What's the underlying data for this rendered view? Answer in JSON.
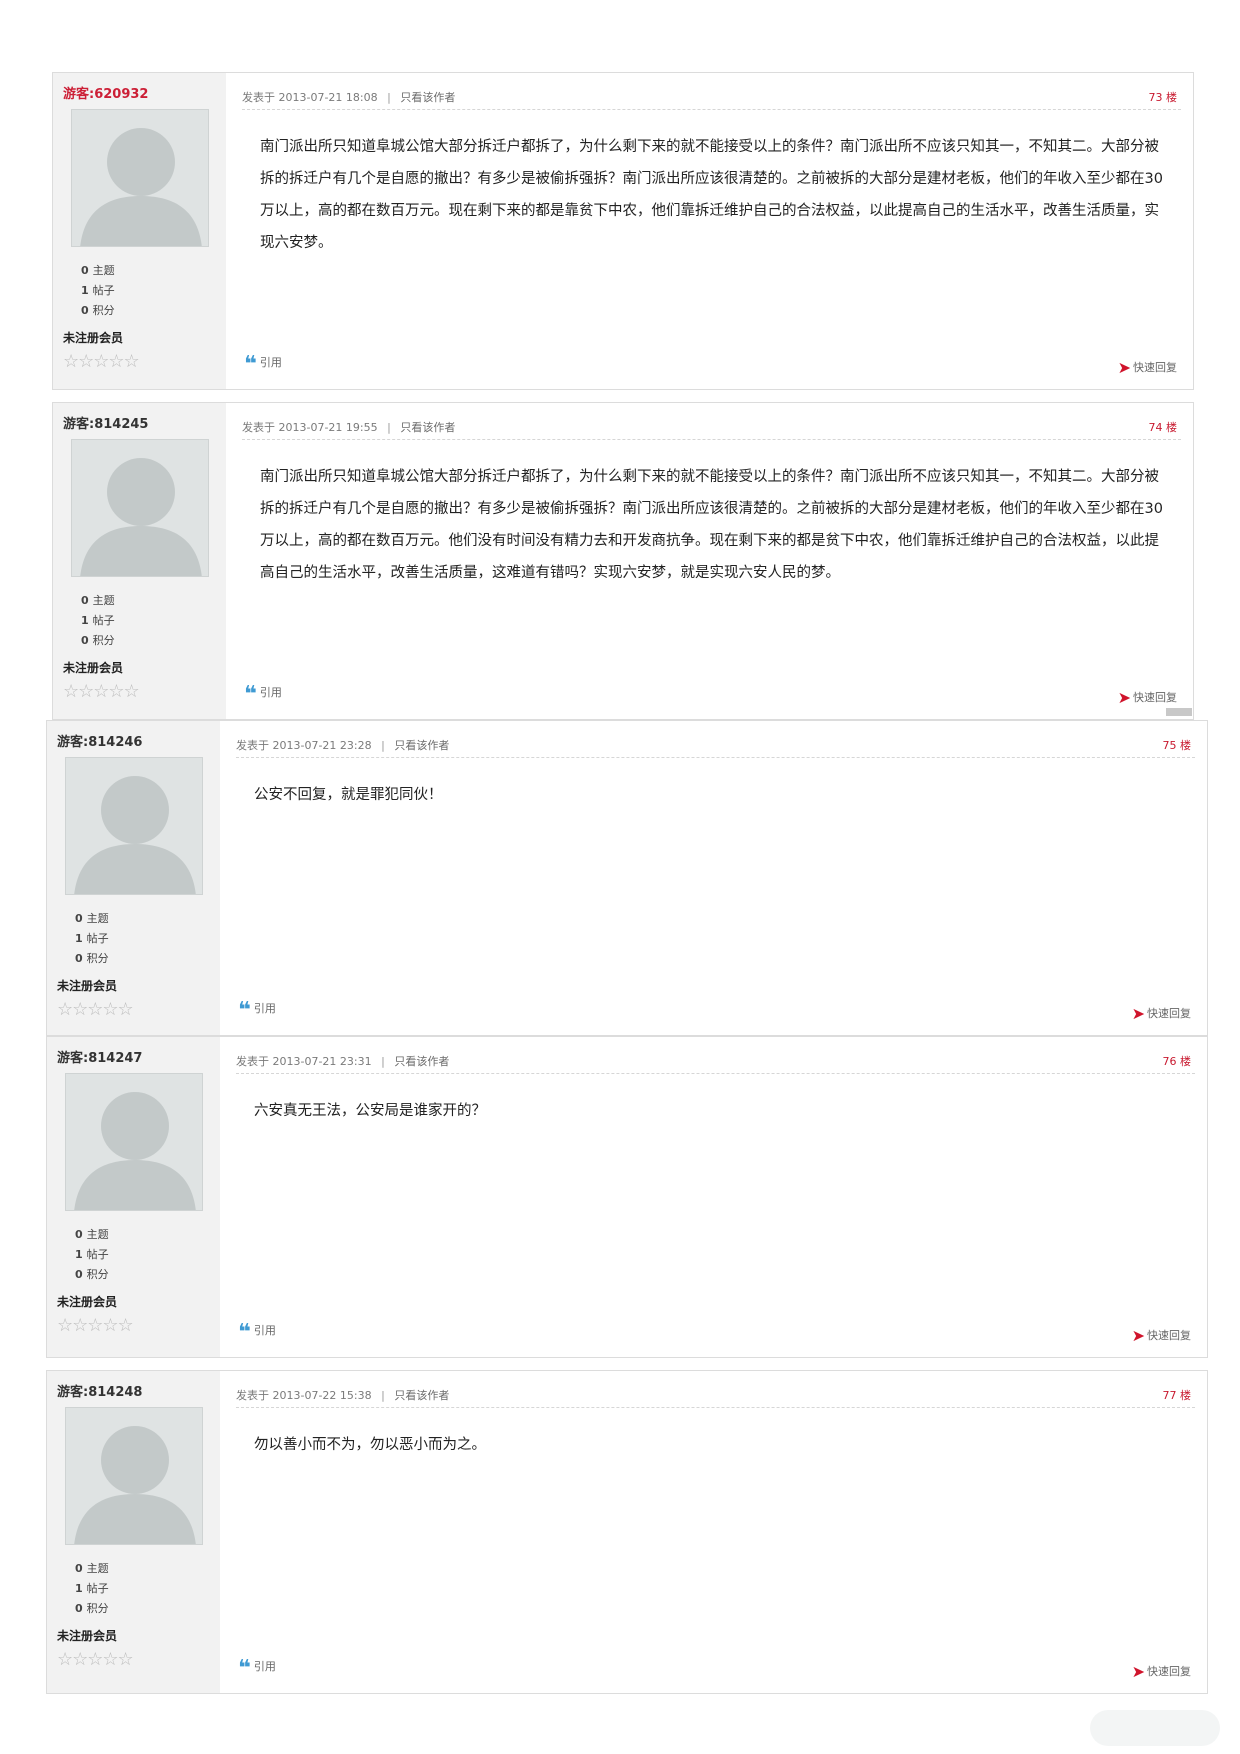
{
  "labels": {
    "posted_prefix": "发表于",
    "view_author": "只看该作者",
    "quote": "引用",
    "quick_reply": "快速回复",
    "threads_label": "主题",
    "posts_label": "帖子",
    "points_label": "积分",
    "rank": "未注册会员",
    "stars": "☆☆☆☆☆"
  },
  "posts": [
    {
      "user": "游客:620932",
      "time": "2013-07-21 18:08",
      "floor": "73 楼",
      "threads": "0",
      "posts": "1",
      "points": "0",
      "content": "南门派出所只知道阜城公馆大部分拆迁户都拆了，为什么剩下来的就不能接受以上的条件？南门派出所不应该只知其一，不知其二。大部分被拆的拆迁户有几个是自愿的撤出？有多少是被偷拆强拆？南门派出所应该很清楚的。之前被拆的大部分是建材老板，他们的年收入至少都在30万以上，高的都在数百万元。现在剩下来的都是靠贫下中农，他们靠拆迁维护自己的合法权益，以此提高自己的生活水平，改善生活质量，实现六安梦。"
    },
    {
      "user": "游客:814245",
      "time": "2013-07-21 19:55",
      "floor": "74 楼",
      "threads": "0",
      "posts": "1",
      "points": "0",
      "content": "南门派出所只知道阜城公馆大部分拆迁户都拆了，为什么剩下来的就不能接受以上的条件？南门派出所不应该只知其一，不知其二。大部分被拆的拆迁户有几个是自愿的撤出？有多少是被偷拆强拆？南门派出所应该很清楚的。之前被拆的大部分是建材老板，他们的年收入至少都在30万以上，高的都在数百万元。他们没有时间没有精力去和开发商抗争。现在剩下来的都是贫下中农，他们靠拆迁维护自己的合法权益，以此提高自己的生活水平，改善生活质量，这难道有错吗？实现六安梦，就是实现六安人民的梦。"
    },
    {
      "user": "游客:814246",
      "time": "2013-07-21 23:28",
      "floor": "75 楼",
      "threads": "0",
      "posts": "1",
      "points": "0",
      "content": "公安不回复，就是罪犯同伙！"
    },
    {
      "user": "游客:814247",
      "time": "2013-07-21 23:31",
      "floor": "76 楼",
      "threads": "0",
      "posts": "1",
      "points": "0",
      "content": "六安真无王法，公安局是谁家开的？"
    },
    {
      "user": "游客:814248",
      "time": "2013-07-22 15:38",
      "floor": "77 楼",
      "threads": "0",
      "posts": "1",
      "points": "0",
      "content": "勿以善小而不为，勿以恶小而为之。"
    }
  ]
}
